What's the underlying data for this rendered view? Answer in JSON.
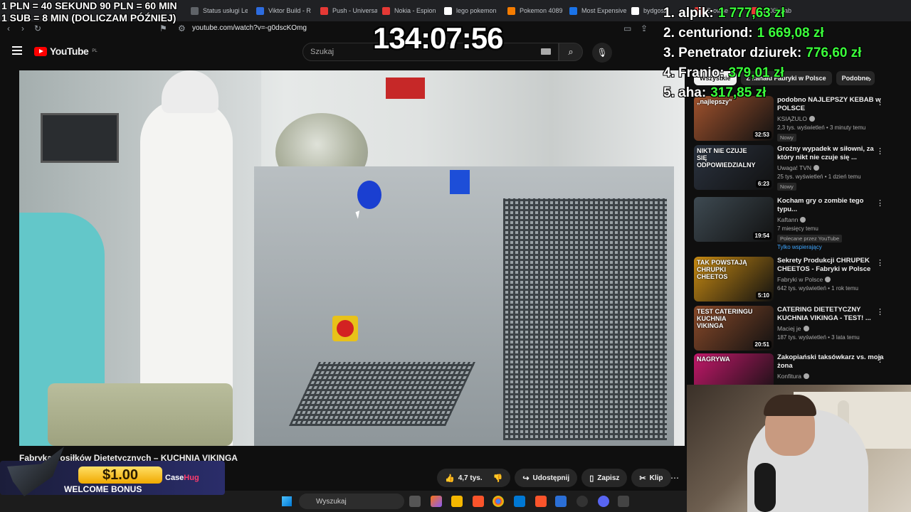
{
  "browser": {
    "tabs": [
      {
        "label": "Status usługi Le",
        "color": "#5f6368"
      },
      {
        "label": "Viktor Build - R",
        "color": "#2d6cdf"
      },
      {
        "label": "Push - Universa",
        "color": "#e53935"
      },
      {
        "label": "Nokia - Espion",
        "color": "#e53935"
      },
      {
        "label": "lego pokemon",
        "color": "#ffffff"
      },
      {
        "label": "Pokemon 4089",
        "color": "#f57c00"
      },
      {
        "label": "Most Expensive",
        "color": "#1a73e8"
      },
      {
        "label": "bydgosz",
        "color": "#ffffff"
      },
      {
        "label": "Browse",
        "color": "#e53935"
      },
      {
        "label": "(408) Fab",
        "color": "#e53935"
      }
    ],
    "url": "youtube.com/watch?v=-g0dscKOmg"
  },
  "youtube": {
    "logo_text": "YouTube",
    "logo_region": "PL",
    "search_placeholder": "Szukaj",
    "video_title": "Fabryka Posiłków Dietetycznych – KUCHNIA VIKINGA",
    "actions": {
      "likes": "4,7 tys.",
      "share": "Udostępnij",
      "save": "Zapisz",
      "clip": "Klip"
    },
    "chips": [
      {
        "label": "Wszystkie",
        "active": true
      },
      {
        "label": "Z kanału Fabryki w Polsce",
        "active": false
      },
      {
        "label": "Podobne",
        "active": false
      }
    ],
    "recommendations": [
      {
        "title": "podobno NAJLEPSZY KEBAB w POLSCE",
        "channel": "KSIĄŻULO",
        "meta": "2,3 tys. wyświetleń • 3 minuty temu",
        "badge": "Nowy",
        "duration": "32:53",
        "caption": "„najlepszy”",
        "thumb": "#a0522d"
      },
      {
        "title": "Groźny wypadek w siłowni, za który nikt nie czuje się ...",
        "channel": "Uwaga! TVN",
        "meta": "25 tys. wyświetleń • 1 dzień temu",
        "badge": "Nowy",
        "duration": "6:23",
        "caption": "NIKT NIE CZUJE SIĘ ODPOWIEDZIALNY",
        "thumb": "#2b3340"
      },
      {
        "title": "Kocham gry o zombie tego typu...",
        "channel": "Kaftann",
        "meta": "7 miesięcy temu",
        "badge": "Polecane przez YouTube",
        "extra": "Tylko wspierający",
        "duration": "19:54",
        "caption": "",
        "thumb": "#3e4a52"
      },
      {
        "title": "Sekrety Produkcji CHRUPEK CHEETOS - Fabryki w Polsce",
        "channel": "Fabryki w Polsce",
        "meta": "642 tys. wyświetleń • 1 rok temu",
        "badge": "",
        "duration": "5:10",
        "caption": "TAK POWSTAJĄ CHRUPKI CHEETOS",
        "thumb": "#c78a12"
      },
      {
        "title": "CATERING DIETETYCZNY KUCHNIA VIKINGA - TEST! ...",
        "channel": "Maciej je",
        "meta": "187 tys. wyświetleń • 3 lata temu",
        "badge": "",
        "duration": "20:51",
        "caption": "TEST CATERINGU KUCHNIA VIKINGA",
        "thumb": "#8a4a2a"
      },
      {
        "title": "Zakopiański taksówkarz vs. moja żona",
        "channel": "Konfitura",
        "meta": "",
        "badge": "",
        "duration": "",
        "caption": "NAGRYWA",
        "thumb": "#c2186a"
      }
    ]
  },
  "overlay": {
    "rate_line1": "1 PLN = 40 SEKUND 90 PLN = 60 MIN",
    "rate_line2": "1 SUB = 8 MIN (DOLICZAM PÓŹNIEJ)",
    "timer": "134:07:56",
    "leaderboard": [
      {
        "name": "1. alpik:",
        "amount": "1 777,63 zł"
      },
      {
        "name": "2. centuriond:",
        "amount": "1 669,08 zł"
      },
      {
        "name": "3. Penetrator dziurek:",
        "amount": "776,60 zł"
      },
      {
        "name": "4. Franio:",
        "amount": "379,01 zł"
      },
      {
        "name": "5. aha:",
        "amount": "317,85 zł"
      }
    ],
    "ad_amount": "$1.00",
    "ad_text": "WELCOME BONUS",
    "ad_brand_a": "Case",
    "ad_brand_b": "Hug"
  },
  "taskbar": {
    "search_placeholder": "Wyszukaj"
  }
}
